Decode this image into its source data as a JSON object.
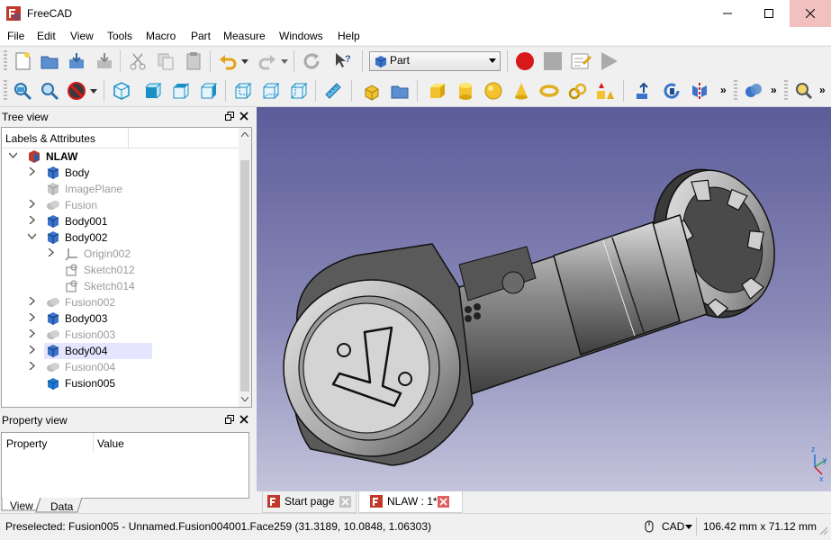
{
  "window": {
    "title": "FreeCAD"
  },
  "menu": [
    "File",
    "Edit",
    "View",
    "Tools",
    "Macro",
    "Part",
    "Measure",
    "Windows",
    "Help"
  ],
  "toolbar": {
    "workbench": "Part"
  },
  "tree_panel": {
    "title": "Tree view",
    "header": "Labels & Attributes",
    "items": [
      {
        "label": "NLAW",
        "level": 0,
        "expander": "open",
        "icon": "document-icon",
        "dim": false,
        "bold": true
      },
      {
        "label": "Body",
        "level": 1,
        "expander": "closed",
        "icon": "body-icon",
        "dim": false
      },
      {
        "label": "ImagePlane",
        "level": 1,
        "expander": "none",
        "icon": "image-plane-icon",
        "dim": true
      },
      {
        "label": "Fusion",
        "level": 1,
        "expander": "closed",
        "icon": "fusion-icon",
        "dim": true
      },
      {
        "label": "Body001",
        "level": 1,
        "expander": "closed",
        "icon": "body-icon",
        "dim": false
      },
      {
        "label": "Body002",
        "level": 1,
        "expander": "open",
        "icon": "body-icon",
        "dim": false
      },
      {
        "label": "Origin002",
        "level": 2,
        "expander": "closed",
        "icon": "origin-icon",
        "dim": true
      },
      {
        "label": "Sketch012",
        "level": 2,
        "expander": "none",
        "icon": "sketch-icon",
        "dim": true
      },
      {
        "label": "Sketch014",
        "level": 2,
        "expander": "none",
        "icon": "sketch-icon",
        "dim": true
      },
      {
        "label": "Fusion002",
        "level": 1,
        "expander": "closed",
        "icon": "fusion-icon",
        "dim": true
      },
      {
        "label": "Body003",
        "level": 1,
        "expander": "closed",
        "icon": "body-icon",
        "dim": false
      },
      {
        "label": "Fusion003",
        "level": 1,
        "expander": "closed",
        "icon": "fusion-icon",
        "dim": true
      },
      {
        "label": "Body004",
        "level": 1,
        "expander": "closed",
        "icon": "body-icon",
        "dim": false,
        "highlight": true
      },
      {
        "label": "Fusion004",
        "level": 1,
        "expander": "closed",
        "icon": "fusion-icon",
        "dim": true
      },
      {
        "label": "Fusion005",
        "level": 1,
        "expander": "none",
        "icon": "solid-icon",
        "dim": false
      }
    ]
  },
  "property_panel": {
    "title": "Property view",
    "col_property": "Property",
    "col_value": "Value",
    "tab_view": "View",
    "tab_data": "Data"
  },
  "doc_tabs": [
    {
      "label": "Start page",
      "active": false
    },
    {
      "label": "NLAW : 1*",
      "active": true
    }
  ],
  "axis": {
    "x": "x",
    "y": "y",
    "z": "z"
  },
  "status": {
    "message": "Preselected: Fusion005 - Unnamed.Fusion004001.Face259 (31.3189, 10.0848, 1.06303)",
    "nav_style": "CAD",
    "dimensions": "106.42 mm x 71.12 mm"
  },
  "colors": {
    "accent_red": "#c0392b",
    "view_top": "#5c5c9a",
    "view_bottom": "#c4c4dc",
    "selection": "#e5e5ff"
  }
}
